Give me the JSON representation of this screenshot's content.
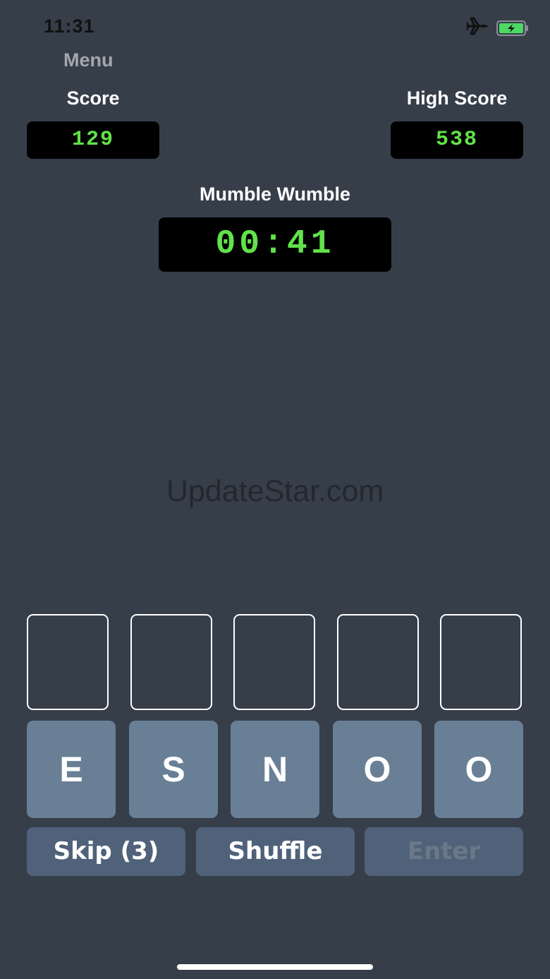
{
  "status_bar": {
    "time": "11:31",
    "icons": [
      "airplane-icon",
      "battery-charging-icon"
    ]
  },
  "header": {
    "menu_label": "Menu"
  },
  "scores": {
    "score_label": "Score",
    "score_value": "129",
    "high_score_label": "High Score",
    "high_score_value": "538"
  },
  "game": {
    "title": "Mumble Wumble",
    "timer": "00:41"
  },
  "watermark": "UpdateStar.com",
  "answer_slots": [
    "",
    "",
    "",
    "",
    ""
  ],
  "letter_tiles": [
    "E",
    "S",
    "N",
    "O",
    "O"
  ],
  "actions": {
    "skip_label": "Skip (3)",
    "shuffle_label": "Shuffle",
    "enter_label": "Enter"
  },
  "colors": {
    "background": "#363e4a",
    "lcd_background": "#000000",
    "lcd_text": "#62e24a",
    "tile": "#697f96",
    "button": "#50627a",
    "battery": "#4cd964"
  }
}
